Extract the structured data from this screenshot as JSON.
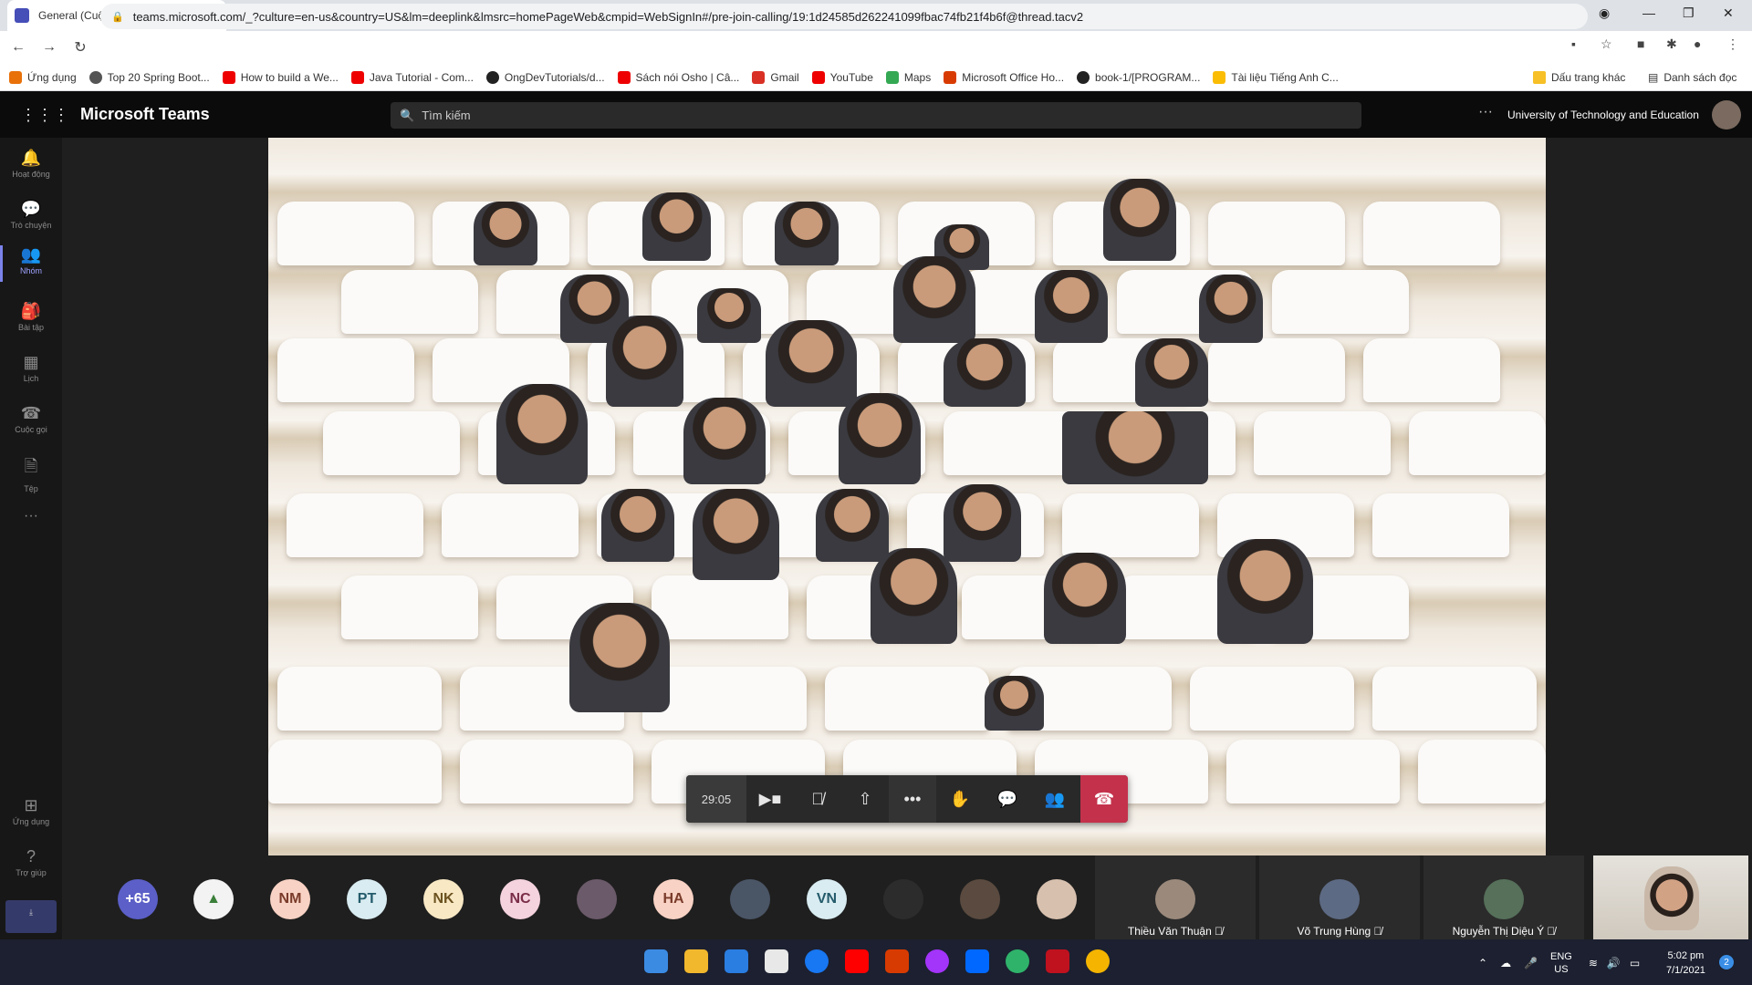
{
  "browser": {
    "tab_title": "General (Cuộc họp) | Microsoft Teams",
    "url": "teams.microsoft.com/_?culture=en-us&country=US&lm=deeplink&lmsrc=homePageWeb&cmpid=WebSignIn#/pre-join-calling/19:1d24585d262241099fbac74fb21f4b6f@thread.tacv2",
    "bookmarks": [
      "Ứng dụng",
      "Top 20 Spring Boot...",
      "How to build a We...",
      "Java Tutorial - Com...",
      "OngDevTutorials/d...",
      "Sách nói Osho | Câ...",
      "Gmail",
      "YouTube",
      "Maps",
      "Microsoft Office Ho...",
      "book-1/[PROGRAM...",
      "Tài liệu Tiếng Anh C..."
    ],
    "bookmark_other": "Dấu trang khác",
    "reading_list": "Danh sách đọc"
  },
  "teams": {
    "app_name": "Microsoft Teams",
    "search_placeholder": "Tìm kiếm",
    "org": "University of Technology and Education",
    "rail": [
      "Hoạt động",
      "Trò chuyện",
      "Nhóm",
      "Bài tập",
      "Lịch",
      "Cuộc gọi",
      "Tệp",
      "Ứng dụng",
      "Trợ giúp"
    ],
    "call": {
      "timer": "29:05"
    },
    "participants": {
      "overflow": "+65",
      "initials": [
        "NM",
        "PT",
        "NK",
        "NC",
        "HA",
        "VN"
      ],
      "tiles": [
        "Thiều Văn Thuận",
        "Võ Trung Hùng",
        "Nguyễn Thị Diệu Ý"
      ]
    }
  },
  "taskbar": {
    "lang1": "ENG",
    "lang2": "US",
    "time": "5:02 pm",
    "date": "7/1/2021",
    "notifications": "2"
  }
}
